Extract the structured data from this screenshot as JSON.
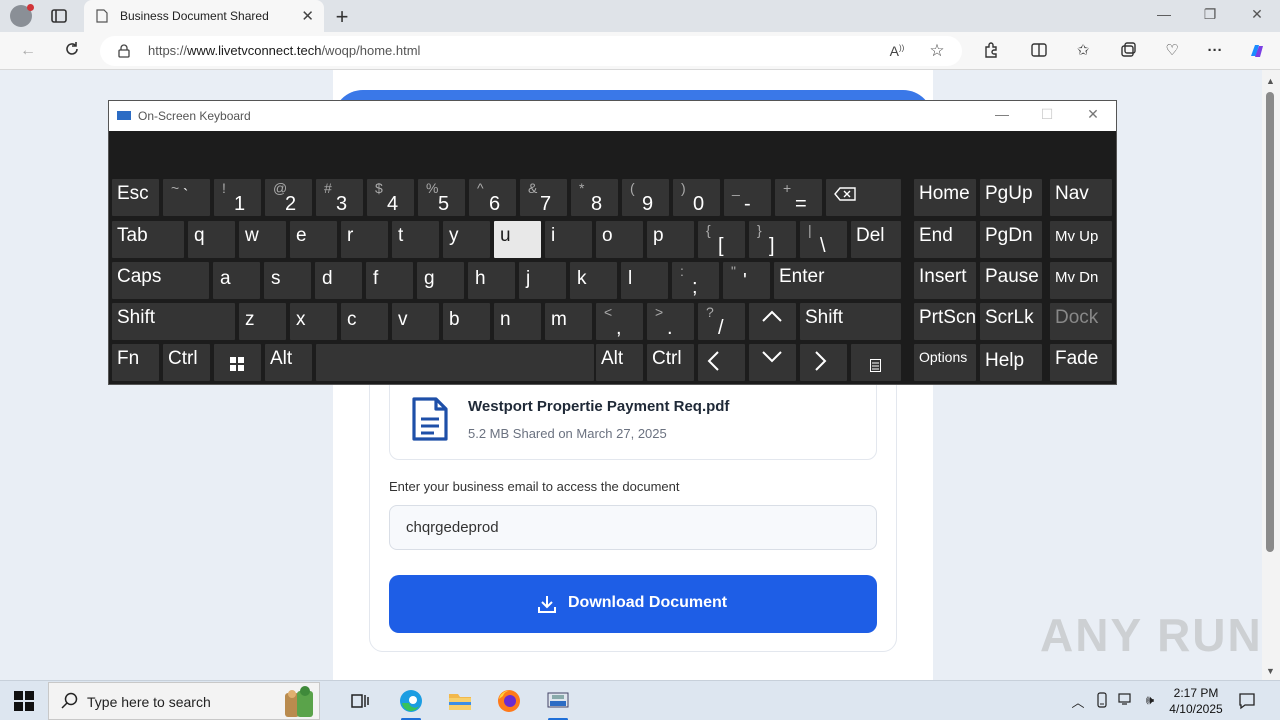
{
  "browser": {
    "tab_title": "Business Document Shared",
    "url_prefix": "https://",
    "url_domain": "www.livetvconnect.tech",
    "url_path": "/woqp/home.html"
  },
  "document": {
    "file_name": "Westport Propertie Payment Req.pdf",
    "meta": "5.2 MB Shared on March 27, 2025"
  },
  "form": {
    "email_label": "Enter your business email to access the document",
    "email_value": "chqrgedeprod",
    "download_label": "Download Document"
  },
  "watermark": "ANY RUN",
  "osk": {
    "title": "On-Screen Keyboard",
    "highlighted_key": "u",
    "keys": {
      "esc": "Esc",
      "tab": "Tab",
      "caps": "Caps",
      "shift": "Shift",
      "fn": "Fn",
      "ctrl": "Ctrl",
      "alt": "Alt",
      "del": "Del",
      "enter": "Enter",
      "home": "Home",
      "pgup": "PgUp",
      "nav": "Nav",
      "end": "End",
      "pgdn": "PgDn",
      "mvup": "Mv Up",
      "insert": "Insert",
      "pause": "Pause",
      "mvdn": "Mv Dn",
      "prtscn": "PrtScn",
      "scrlk": "ScrLk",
      "dock": "Dock",
      "options": "Options",
      "help": "Help",
      "fade": "Fade",
      "row_q": [
        "q",
        "w",
        "e",
        "r",
        "t",
        "y",
        "u",
        "i",
        "o",
        "p"
      ],
      "row_a": [
        "a",
        "s",
        "d",
        "f",
        "g",
        "h",
        "j",
        "k",
        "l"
      ],
      "row_z": [
        "z",
        "x",
        "c",
        "v",
        "b",
        "n",
        "m"
      ]
    }
  },
  "taskbar": {
    "search_placeholder": "Type here to search",
    "time": "2:17 PM",
    "date": "4/10/2025"
  },
  "colors": {
    "accent_blue": "#1e5ee6",
    "header_blue": "#3a78e8",
    "osk_bg": "#1c1c1c",
    "osk_key": "#343434"
  }
}
